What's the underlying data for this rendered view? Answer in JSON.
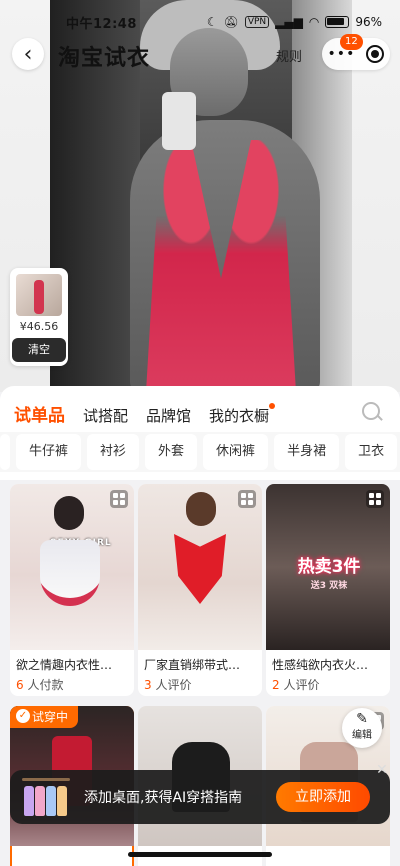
{
  "status_bar": {
    "time": "中午12:48",
    "vpn": "VPN",
    "battery": "96"
  },
  "header": {
    "title": "淘宝试衣",
    "rules": "规则",
    "notification_count": "12"
  },
  "tryon_card": {
    "price": "¥46.56",
    "clear_label": "清空"
  },
  "tabs": [
    {
      "label": "试单品",
      "active": true
    },
    {
      "label": "试搭配"
    },
    {
      "label": "品牌馆"
    },
    {
      "label": "我的衣橱",
      "dot": true
    }
  ],
  "categories": [
    "牛仔裤",
    "衬衫",
    "外套",
    "休闲裤",
    "半身裙",
    "卫衣"
  ],
  "products": [
    {
      "name": "欲之情趣内衣性…",
      "count": "6",
      "count_suffix": "人付款",
      "tag": "SEXY GIRL"
    },
    {
      "name": "厂家直销绑带式…",
      "count": "3",
      "count_suffix": "人评价"
    },
    {
      "name": "性感纯欲内衣火…",
      "count": "2",
      "count_suffix": "人评价",
      "hot_title": "热卖3件",
      "hot_sub": "送3 双袜"
    }
  ],
  "trying_label": "试穿中",
  "edit_label": "编辑",
  "promo": {
    "text": "添加桌面,获得AI穿搭指南",
    "button": "立即添加"
  },
  "colors": {
    "accent": "#ff5000",
    "promo_bg": "#1c1c1c"
  }
}
